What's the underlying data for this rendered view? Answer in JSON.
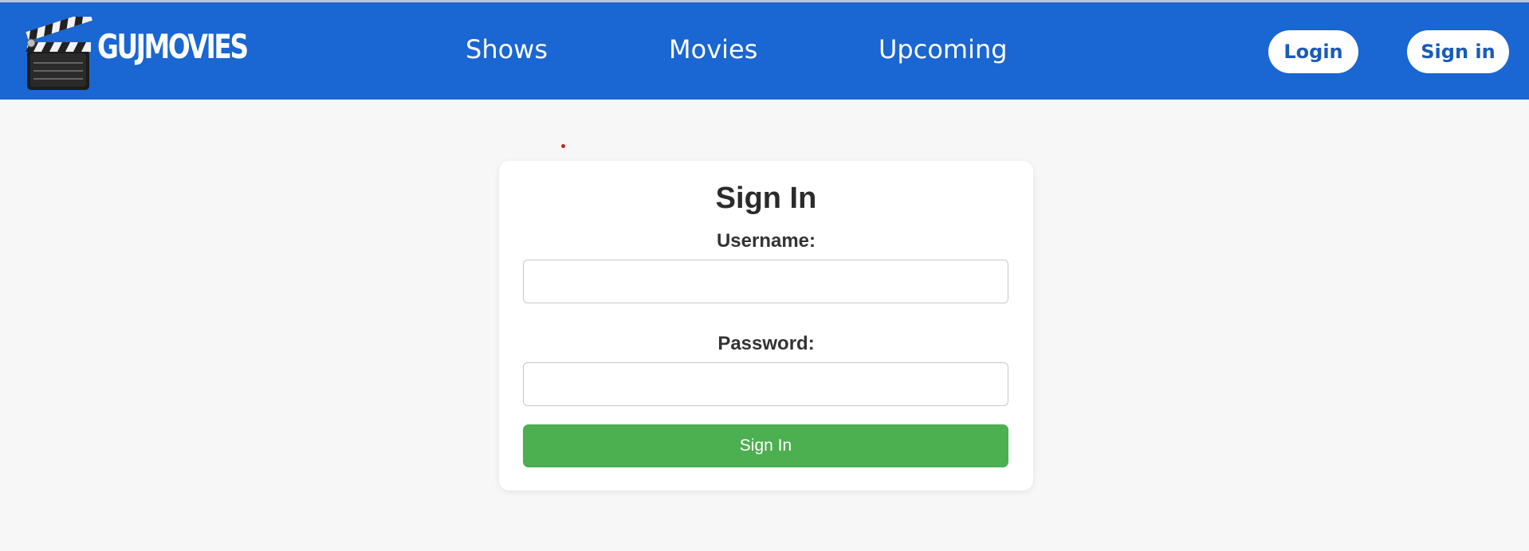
{
  "header": {
    "logo_text": "GUJMOVIES",
    "logo_icon": "clapperboard-icon",
    "nav": {
      "shows": "Shows",
      "movies": "Movies",
      "upcoming": "Upcoming"
    },
    "login_label": "Login",
    "signin_label": "Sign in"
  },
  "form": {
    "title": "Sign In",
    "username_label": "Username:",
    "username_value": "",
    "password_label": "Password:",
    "password_value": "",
    "submit_label": "Sign In"
  },
  "colors": {
    "navbar": "#1a66d2",
    "submit": "#4caf50",
    "background": "#f7f7f7"
  }
}
